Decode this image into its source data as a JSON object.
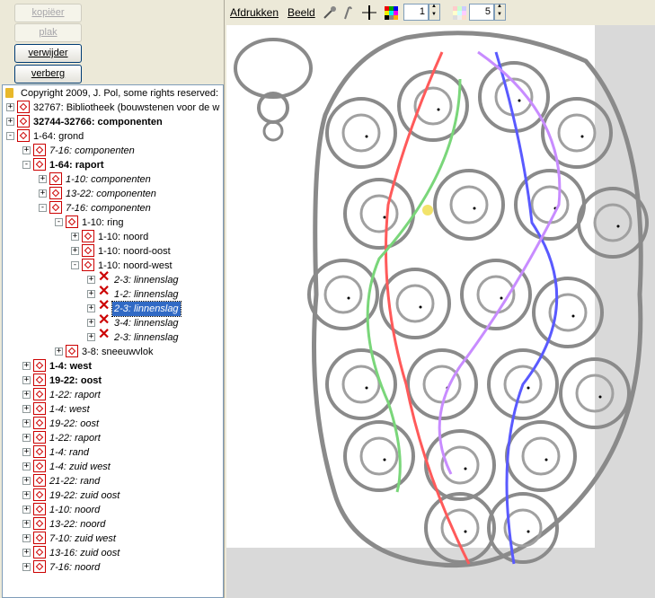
{
  "buttons": {
    "copy": "kopiëer",
    "paste": "plak",
    "delete": "verwijder",
    "hide": "verberg"
  },
  "toolbar": {
    "print": "Afdrukken",
    "view": "Beeld",
    "spin1": "1",
    "spin2": "5"
  },
  "tree": [
    {
      "label": "Copyright 2009, J. Pol, some rights reserved:",
      "style": "",
      "icon": "folder"
    },
    {
      "label": "32767: Bibliotheek (bouwstenen voor de w",
      "style": "",
      "icon": "diamond"
    },
    {
      "label": "32744-32766: componenten",
      "style": "b",
      "icon": "diamond"
    },
    {
      "label": "1-64: grond",
      "style": "",
      "icon": "diamond"
    },
    {
      "label": "7-16: componenten",
      "style": "it",
      "icon": "diamond"
    },
    {
      "label": "1-64: raport",
      "style": "b",
      "icon": "diamond"
    },
    {
      "label": "1-10: componenten",
      "style": "it",
      "icon": "diamond"
    },
    {
      "label": "13-22: componenten",
      "style": "it",
      "icon": "diamond"
    },
    {
      "label": "7-16: componenten",
      "style": "it",
      "icon": "diamond"
    },
    {
      "label": "1-10: ring",
      "style": "",
      "icon": "diamond"
    },
    {
      "label": "1-10: noord",
      "style": "",
      "icon": "diamond"
    },
    {
      "label": "1-10: noord-oost",
      "style": "",
      "icon": "diamond"
    },
    {
      "label": "1-10: noord-west",
      "style": "",
      "icon": "diamond"
    },
    {
      "label": "2-3: linnenslag",
      "style": "it",
      "icon": "x"
    },
    {
      "label": "1-2: linnenslag",
      "style": "it",
      "icon": "x"
    },
    {
      "label": "2-3: linnenslag",
      "style": "it sel",
      "icon": "x"
    },
    {
      "label": "3-4: linnenslag",
      "style": "it",
      "icon": "x"
    },
    {
      "label": "2-3: linnenslag",
      "style": "it",
      "icon": "x"
    },
    {
      "label": "3-8: sneeuwvlok",
      "style": "",
      "icon": "diamond"
    },
    {
      "label": "1-4: west",
      "style": "b",
      "icon": "diamond"
    },
    {
      "label": "19-22: oost",
      "style": "b",
      "icon": "diamond"
    },
    {
      "label": "1-22: raport",
      "style": "it",
      "icon": "diamond"
    },
    {
      "label": "1-4: west",
      "style": "it",
      "icon": "diamond"
    },
    {
      "label": "19-22: oost",
      "style": "it",
      "icon": "diamond"
    },
    {
      "label": "1-22: raport",
      "style": "it",
      "icon": "diamond"
    },
    {
      "label": "1-4: rand",
      "style": "it",
      "icon": "diamond"
    },
    {
      "label": "1-4: zuid west",
      "style": "it",
      "icon": "diamond"
    },
    {
      "label": "21-22: rand",
      "style": "it",
      "icon": "diamond"
    },
    {
      "label": "19-22: zuid oost",
      "style": "it",
      "icon": "diamond"
    },
    {
      "label": "1-10: noord",
      "style": "it",
      "icon": "diamond"
    },
    {
      "label": "13-22: noord",
      "style": "it",
      "icon": "diamond"
    },
    {
      "label": "7-10: zuid west",
      "style": "it",
      "icon": "diamond"
    },
    {
      "label": "13-16: zuid oost",
      "style": "it",
      "icon": "diamond"
    },
    {
      "label": "7-16: noord",
      "style": "it",
      "icon": "diamond"
    }
  ],
  "colors": {
    "selection": "#316ac5",
    "icon_red": "#cc0000",
    "thread_red": "#ff5a5a",
    "thread_blue": "#5a5aff",
    "thread_green": "#7ad67a",
    "thread_purple": "#c88cff"
  }
}
